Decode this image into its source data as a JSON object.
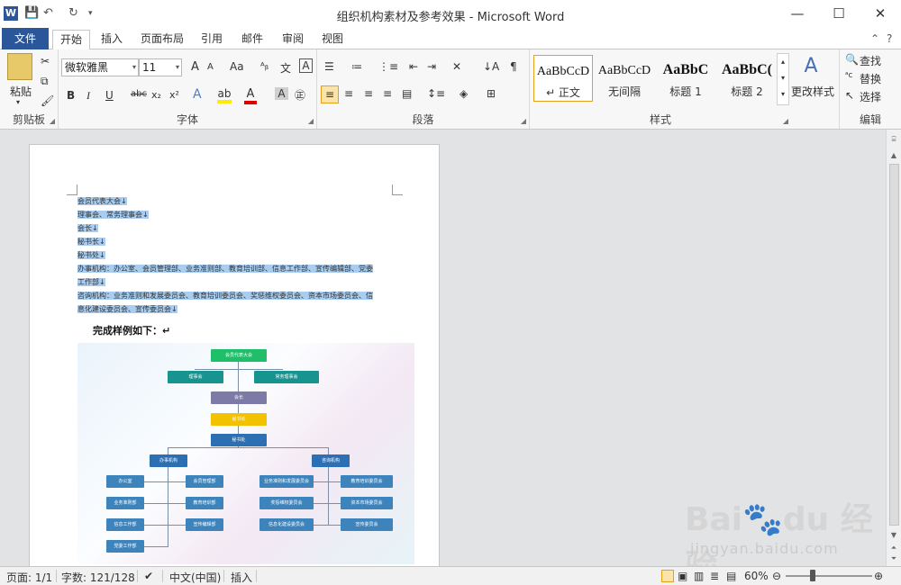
{
  "window": {
    "title": "组织机构素材及参考效果 - Microsoft Word",
    "min": "—",
    "max": "☐",
    "close": "✕"
  },
  "quick_access": {
    "save": "💾",
    "undo": "↶",
    "redo": "↻",
    "more": "▾"
  },
  "tabs": [
    "文件",
    "开始",
    "插入",
    "页面布局",
    "引用",
    "邮件",
    "审阅",
    "视图"
  ],
  "ribbon": {
    "clipboard": {
      "label": "剪贴板",
      "paste": "粘贴"
    },
    "font": {
      "label": "字体",
      "name": "微软雅黑",
      "size": "11",
      "grow": "A",
      "shrink": "A",
      "case": "Aa",
      "bold": "B",
      "italic": "I",
      "underline": "U",
      "strike": "abc",
      "sub": "x₂",
      "sup": "x²"
    },
    "paragraph": {
      "label": "段落"
    },
    "styles": {
      "label": "样式",
      "items": [
        {
          "sample": "AaBbCcD",
          "name": "↵ 正文"
        },
        {
          "sample": "AaBbCcD",
          "name": "无间隔"
        },
        {
          "sample": "AaBbC",
          "name": "标题 1"
        },
        {
          "sample": "AaBbC(",
          "name": "标题 2"
        }
      ],
      "change": "更改样式"
    },
    "editing": {
      "label": "编辑",
      "find": "查找",
      "replace": "替换",
      "select": "选择"
    }
  },
  "document": {
    "lines": [
      "会员代表大会↓",
      "理事会、常务理事会↓",
      "会长↓",
      "秘书长↓",
      "秘书处↓",
      "办事机构：办公室、会员管理部、业务准则部、教育培训部、信息工作部、宣传编辑部、党委",
      "工作部↓",
      "咨询机构：业务准则和发展委员会、教育培训委员会、奖惩维权委员会、资本市场委员会、信",
      "息化建设委员会、宣传委员会↓"
    ],
    "example_label": "完成样例如下：↵",
    "org": {
      "top": "会员代表大会",
      "l2a": "理事会",
      "l2b": "常务理事会",
      "chair": "会长",
      "secgen": "秘书长",
      "office": "秘书处",
      "branch_a": "办事机构",
      "branch_b": "咨询机构",
      "a_col1": [
        "办公室",
        "业务准则部",
        "信息工作部",
        "党委工作部"
      ],
      "a_col2": [
        "会员管理部",
        "教育培训部",
        "宣传编辑部"
      ],
      "b_col1": [
        "业务准则和发展委员会",
        "奖惩维权委员会",
        "信息化建设委员会"
      ],
      "b_col2": [
        "教育培训委员会",
        "资本市场委员会",
        "宣传委员会"
      ]
    }
  },
  "status": {
    "page": "页面: 1/1",
    "words": "字数: 121/128",
    "lang": "中文(中国)",
    "mode": "插入",
    "zoom": "60%",
    "zoom_level_percent": 60
  },
  "watermark": {
    "brand": "Bai🐾du 经验",
    "url": "jingyan.baidu.com"
  },
  "colors": {
    "accent": "#2b579a",
    "selection": "#a8cdf0"
  }
}
